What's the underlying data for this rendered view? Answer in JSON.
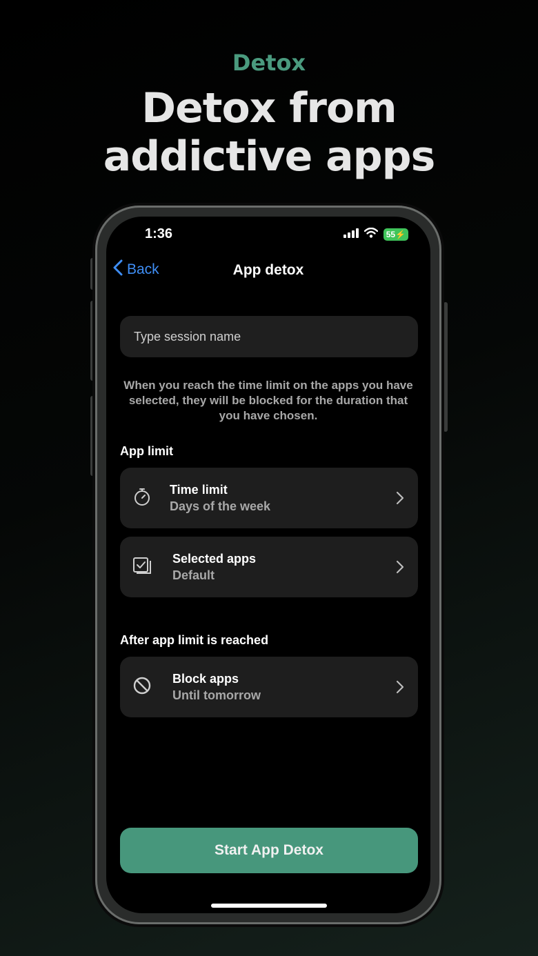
{
  "promo": {
    "eyebrow": "Detox",
    "headline_line1": "Detox from",
    "headline_line2": "addictive apps"
  },
  "status_bar": {
    "time": "1:36",
    "battery": "55"
  },
  "nav": {
    "back_label": "Back",
    "title": "App detox"
  },
  "session": {
    "placeholder": "Type session name"
  },
  "info_text": "When you reach the time limit on the apps you have selected, they will be blocked for the duration that you have chosen.",
  "sections": {
    "app_limit_label": "App limit",
    "after_limit_label": "After app limit is reached"
  },
  "cards": [
    {
      "title": "Time limit",
      "subtitle": "Days of the week",
      "icon": "stopwatch-icon"
    },
    {
      "title": "Selected apps",
      "subtitle": "Default",
      "icon": "checklist-icon"
    },
    {
      "title": "Block apps",
      "subtitle": "Until tomorrow",
      "icon": "block-icon"
    }
  ],
  "start_button": "Start App Detox",
  "colors": {
    "accent": "#47977c",
    "eyebrow": "#4a9a7e",
    "link": "#3f8ef5",
    "card_bg": "#1e1e1e",
    "battery": "#3fc45a"
  }
}
